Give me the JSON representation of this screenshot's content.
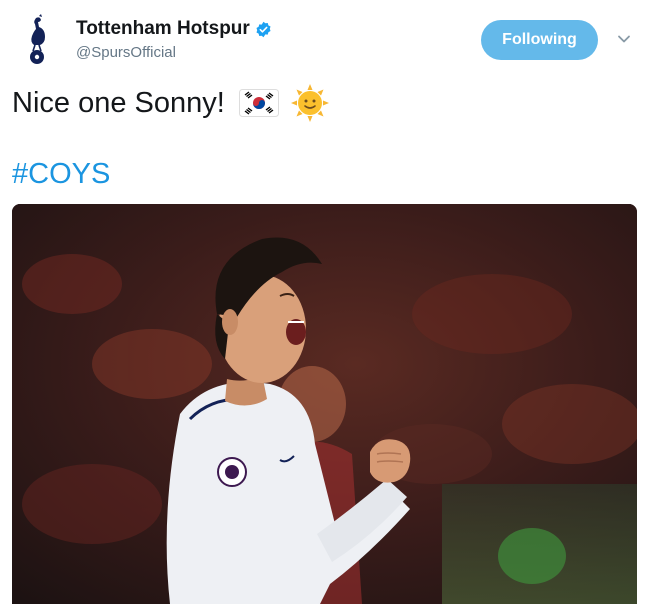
{
  "account": {
    "display_name": "Tottenham Hotspur",
    "handle": "@SpursOfficial",
    "verified": true,
    "avatar_icon": "spurs-cockerel-icon"
  },
  "follow_button": {
    "label": "Following",
    "color": "#64b9ea"
  },
  "menu": {
    "icon": "chevron-down-icon"
  },
  "tweet": {
    "text": "Nice one Sonny!",
    "emojis": [
      "south-korea-flag-icon",
      "sun-face-icon"
    ],
    "hashtag": "#COYS",
    "hashtag_color": "#1b95e0"
  },
  "media": {
    "description_icon": "player-celebration-photo"
  }
}
